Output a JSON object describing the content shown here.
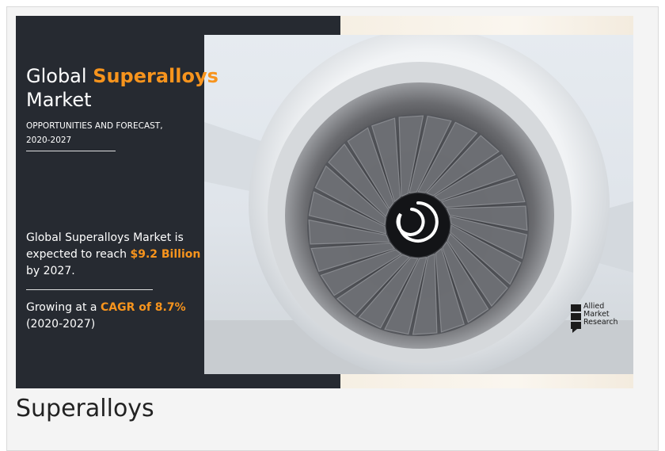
{
  "banner": {
    "title_prefix": "Global ",
    "title_highlight": "Superalloys",
    "title_line2": "Market",
    "subtitle_line1": "OPPORTUNITIES AND FORECAST,",
    "subtitle_line2": "2020-2027",
    "reach_text_before": "Global Superalloys Market is expected to reach ",
    "reach_value": "$9.2 Billion",
    "reach_text_after": " by 2027.",
    "growing_before": "Growing at a ",
    "growing_cagr": "CAGR of 8.7%",
    "growing_period": "(2020-2027)",
    "logo_lines": [
      "Allied",
      "Market",
      "Research"
    ],
    "highlight_color": "#f7941d",
    "panel_color": "#262a31"
  },
  "caption": "Superalloys"
}
